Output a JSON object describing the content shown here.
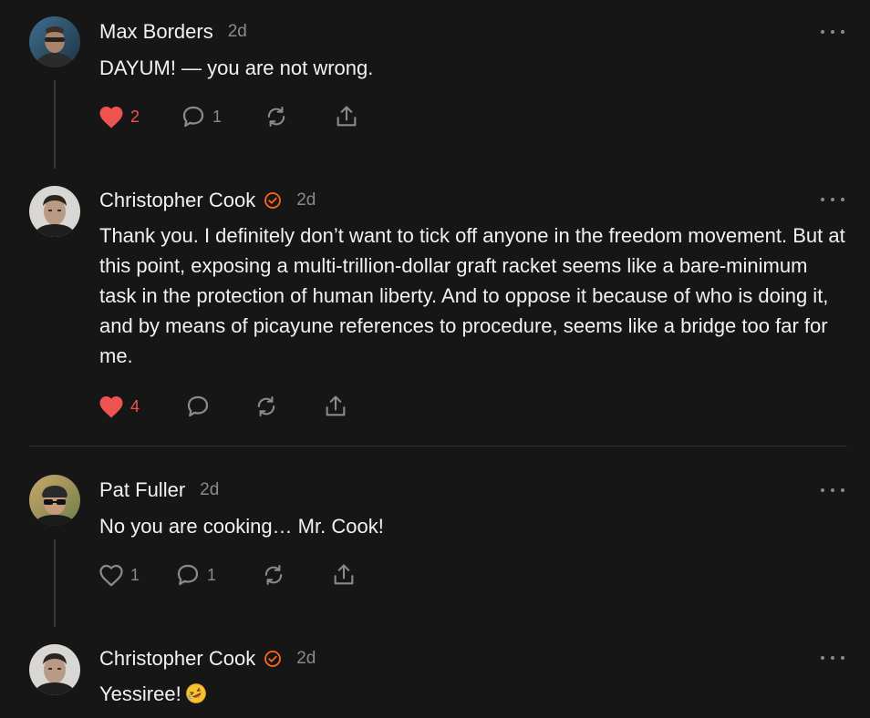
{
  "colors": {
    "background": "#161617",
    "text": "#f2f2f2",
    "muted": "#8a8a8e",
    "like": "#ef5350",
    "verified": "#ff6719"
  },
  "comments": [
    {
      "author": "Max Borders",
      "time": "2d",
      "verified": false,
      "body": "DAYUM! — you are not wrong.",
      "likes": "2",
      "liked": true,
      "replies": "1",
      "avatar_icon": "avatar-max-borders"
    },
    {
      "author": "Christopher Cook",
      "time": "2d",
      "verified": true,
      "body": "Thank you. I definitely don’t want to tick off anyone in the freedom movement. But at this point, exposing a multi-trillion-dollar graft racket seems like a bare-minimum task in the protection of human liberty. And to oppose it because of who is doing it, and by means of picayune references to procedure, seems like a bridge too far for me.",
      "likes": "4",
      "liked": true,
      "replies": "",
      "avatar_icon": "avatar-christopher-cook"
    },
    {
      "author": "Pat Fuller",
      "time": "2d",
      "verified": false,
      "body": "No you are cooking… Mr. Cook!",
      "likes": "1",
      "liked": false,
      "replies": "1",
      "avatar_icon": "avatar-pat-fuller"
    },
    {
      "author": "Christopher Cook",
      "time": "2d",
      "verified": true,
      "body": "Yessiree!",
      "emoji": "rolling-on-floor-laughing-emoji",
      "avatar_icon": "avatar-christopher-cook"
    }
  ]
}
